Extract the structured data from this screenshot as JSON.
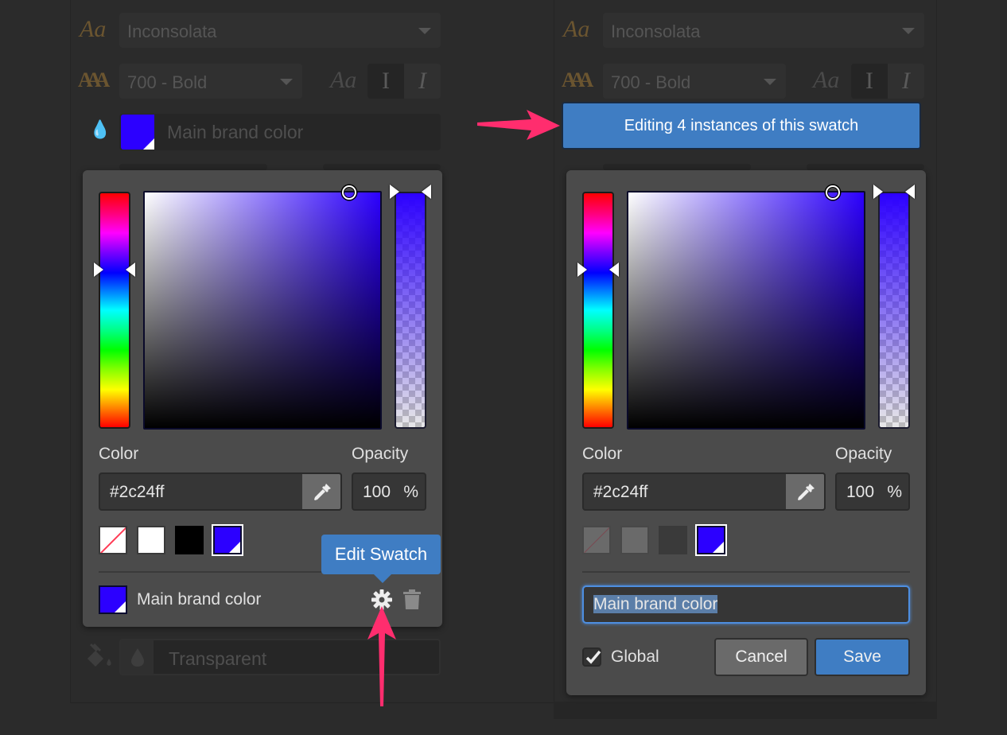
{
  "background_panel": {
    "font_family_value": "Inconsolata",
    "font_weight_value": "700 - Bold",
    "style_sample_label": "Aa",
    "style_normal_label": "I",
    "style_italic_label": "I",
    "text_color_label": "Main brand color",
    "fill_label": "Transparent"
  },
  "color_picker": {
    "color_label": "Color",
    "opacity_label": "Opacity",
    "hex_value": "#2c24ff",
    "opacity_value": "100",
    "opacity_unit": "%",
    "hue_level_fraction": 0.33,
    "saturation": 0.87,
    "brightness": 1.0,
    "alpha": 1.0,
    "swatches": [
      {
        "name": "none",
        "color": "transparent"
      },
      {
        "name": "white",
        "color": "#ffffff"
      },
      {
        "name": "black",
        "color": "#000000"
      },
      {
        "name": "main-brand",
        "color": "#2c00ff",
        "selected": true
      }
    ],
    "selected_swatch_name": "Main brand color"
  },
  "left_state": {
    "tooltip": "Edit Swatch"
  },
  "right_state": {
    "banner": "Editing 4 instances of this swatch",
    "name_input_value": "Main brand color",
    "global_checked": true,
    "global_label": "Global",
    "cancel_label": "Cancel",
    "save_label": "Save"
  },
  "colors": {
    "accent": "#3f7dc3",
    "annotation_arrow": "#ff2d6e",
    "brand": "#2c00ff"
  }
}
